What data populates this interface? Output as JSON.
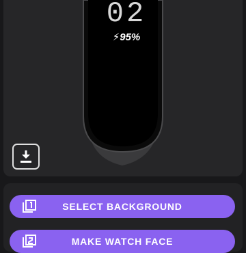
{
  "watch": {
    "time": "02",
    "battery": "⚡95%"
  },
  "actions": {
    "select_background": "SELECT BACKGROUND",
    "make_watch_face": "MAKE WATCH FACE"
  },
  "icons": {
    "download": "download-icon",
    "select": "layers-one-icon",
    "make": "layers-two-icon",
    "battery": "lightning-icon"
  },
  "colors": {
    "accent": "#8a62f0",
    "background": "#18181a",
    "card": "#262628"
  }
}
